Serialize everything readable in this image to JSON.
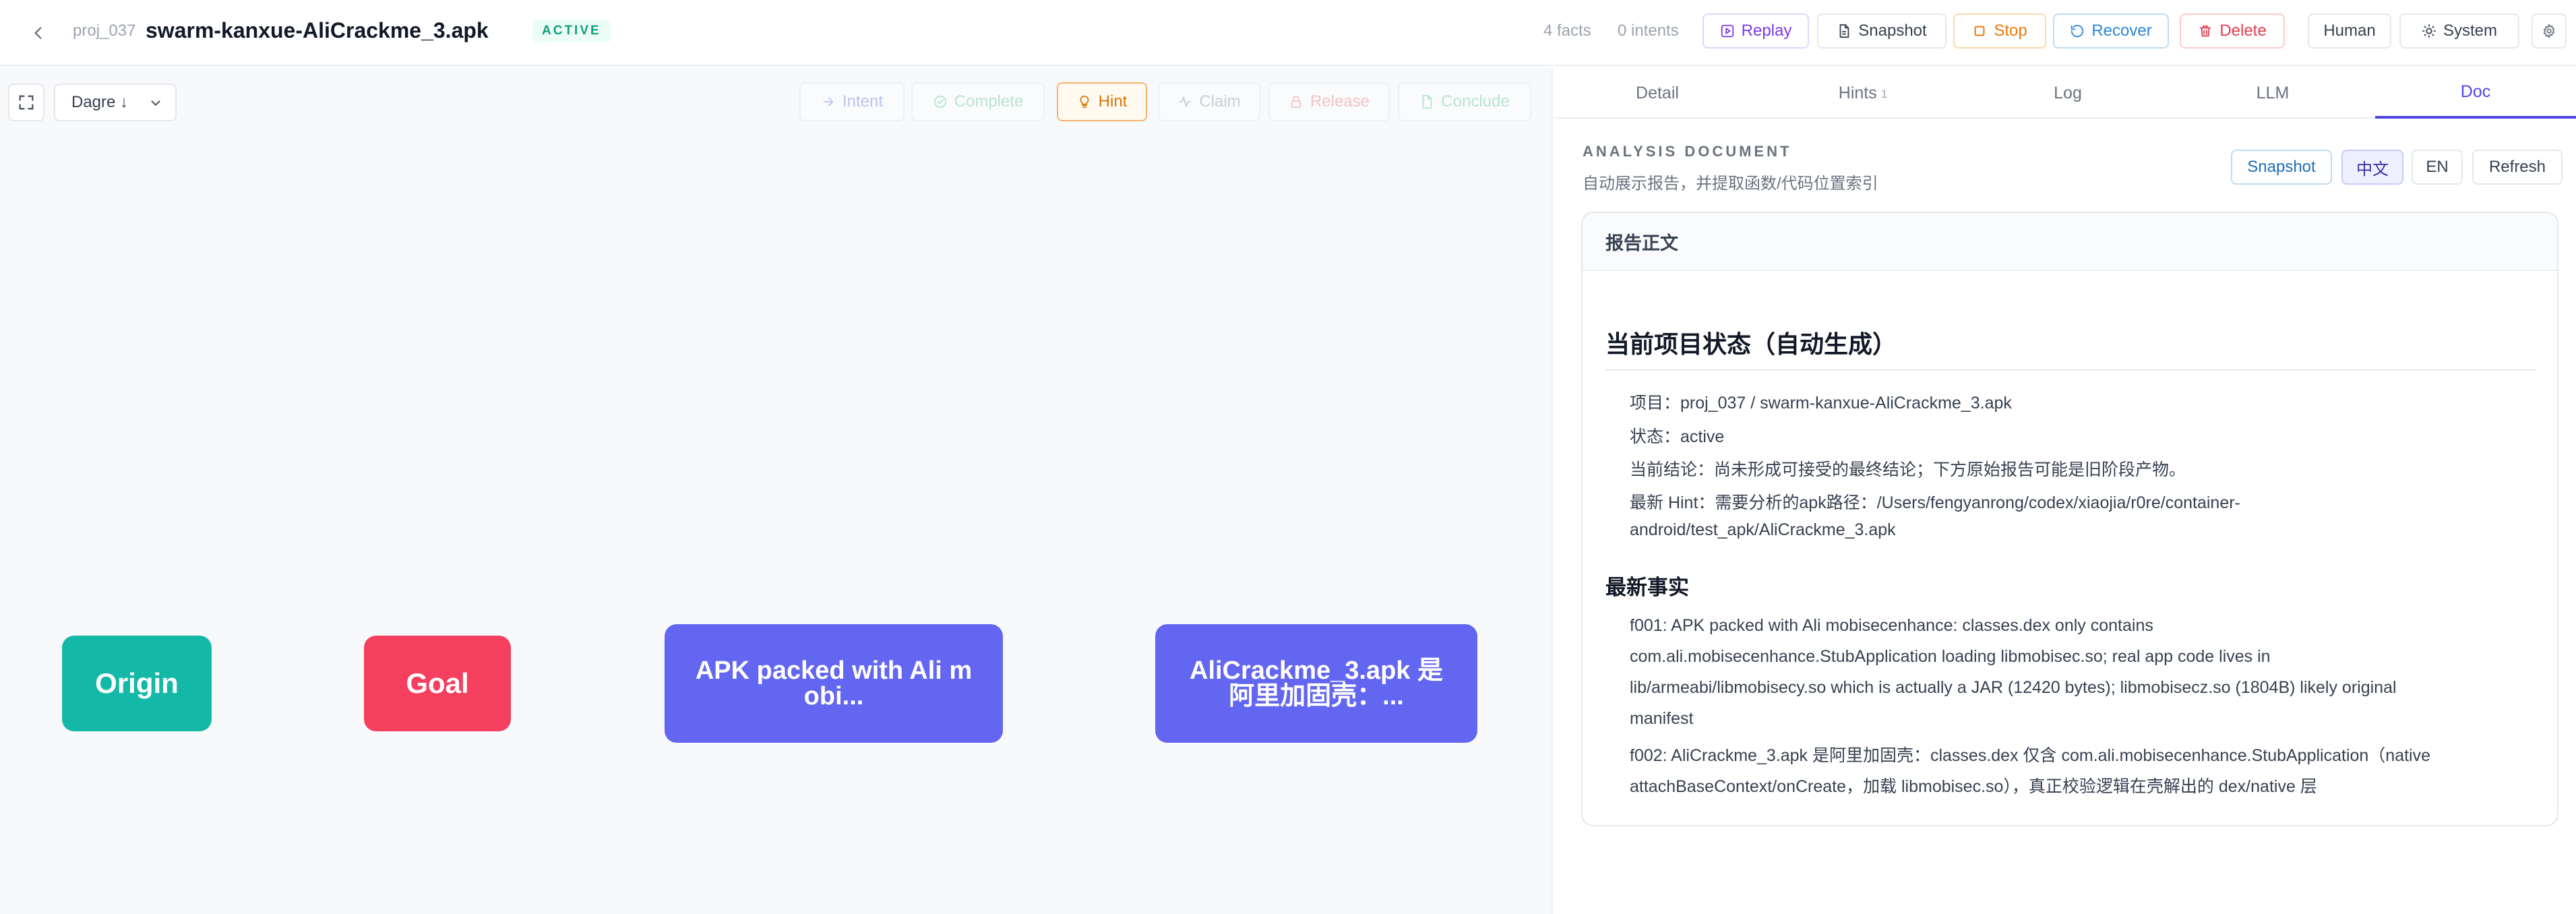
{
  "header": {
    "project_id": "proj_037",
    "project_title": "swarm-kanxue-AliCrackme_3.apk",
    "status": "ACTIVE",
    "facts_count": "4 facts",
    "intents_count": "0 intents",
    "buttons": {
      "replay": "Replay",
      "snapshot": "Snapshot",
      "stop": "Stop",
      "recover": "Recover",
      "delete": "Delete",
      "human": "Human",
      "system": "System"
    }
  },
  "canvas": {
    "layout_value": "Dagre ↓",
    "toolbar": {
      "intent": "Intent",
      "complete": "Complete",
      "hint": "Hint",
      "claim": "Claim",
      "release": "Release",
      "conclude": "Conclude"
    },
    "nodes": {
      "origin": "Origin",
      "goal": "Goal",
      "fact1_line1": "APK packed with Ali m",
      "fact1_line2": "obi...",
      "fact2_line1": "AliCrackme_3.apk 是",
      "fact2_line2": "阿里加固壳：..."
    }
  },
  "panel": {
    "tabs": {
      "detail": "Detail",
      "hints": "Hints",
      "hints_count": "1",
      "log": "Log",
      "llm": "LLM",
      "doc": "Doc"
    },
    "doc_kicker": "ANALYSIS DOCUMENT",
    "doc_subtitle": "自动展示报告，并提取函数/代码位置索引",
    "doc_buttons": {
      "snapshot": "Snapshot",
      "zh": "中文",
      "en": "EN",
      "refresh": "Refresh"
    },
    "card_title": "报告正文",
    "report": {
      "heading": "当前项目状态（自动生成）",
      "project_line": "项目：proj_037 / swarm-kanxue-AliCrackme_3.apk",
      "status_line": "状态：active",
      "conclusion_line": "当前结论：尚未形成可接受的最终结论；下方原始报告可能是旧阶段产物。",
      "hint_line1": "最新 Hint：需要分析的apk路径：/Users/fengyanrong/codex/xiaojia/r0re/container-",
      "hint_line2": "android/test_apk/AliCrackme_3.apk",
      "facts_heading": "最新事实",
      "f001_line1": "f001: APK packed with Ali mobisecenhance: classes.dex only contains",
      "f001_line2": "com.ali.mobisecenhance.StubApplication loading libmobisec.so; real app code lives in",
      "f001_line3": "lib/armeabi/libmobisecy.so which is actually a JAR (12420 bytes); libmobisecz.so (1804B) likely original",
      "f001_line4": "manifest",
      "f002_line1": "f002: AliCrackme_3.apk 是阿里加固壳：classes.dex 仅含 com.ali.mobisecenhance.StubApplication（native",
      "f002_line2": "attachBaseContext/onCreate，加载 libmobisec.so），真正校验逻辑在壳解出的 dex/native 层"
    }
  }
}
